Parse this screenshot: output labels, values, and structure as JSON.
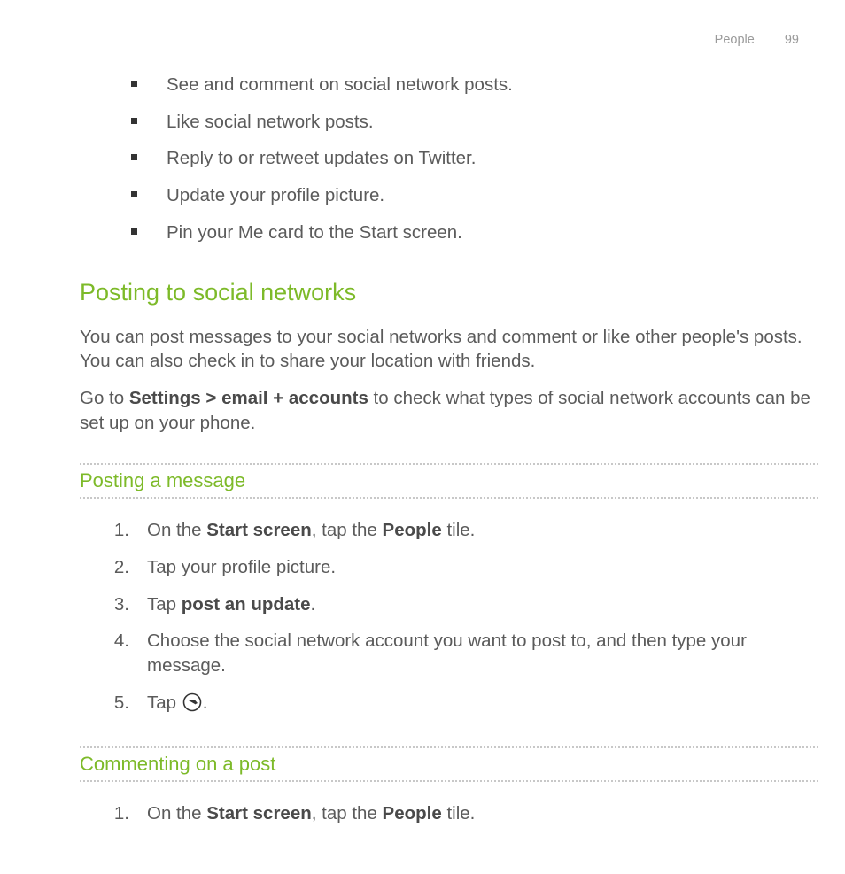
{
  "header": {
    "section": "People",
    "page_number": "99"
  },
  "bullets": [
    "See and comment on social network posts.",
    "Like social network posts.",
    "Reply to or retweet updates on Twitter.",
    "Update your profile picture.",
    "Pin your Me card to the Start screen."
  ],
  "section_title": "Posting to social networks",
  "para1": "You can post messages to your social networks and comment or like other people's posts. You can also check in to share your location with friends.",
  "para2_pre": "Go to ",
  "para2_bold": "Settings > email + accounts",
  "para2_post": " to check what types of social network accounts can be set up on your phone.",
  "sub1": "Posting a message",
  "steps1": {
    "s1_pre": "On the ",
    "s1_b1": "Start screen",
    "s1_mid": ", tap the ",
    "s1_b2": "People",
    "s1_post": " tile.",
    "s2": "Tap your profile picture.",
    "s3_pre": "Tap ",
    "s3_b": "post an update",
    "s3_post": ".",
    "s4": "Choose the social network account you want to post to, and then type your message.",
    "s5_pre": "Tap ",
    "s5_post": "."
  },
  "sub2": "Commenting on a post",
  "steps2": {
    "s1_pre": "On the ",
    "s1_b1": "Start screen",
    "s1_mid": ", tap the ",
    "s1_b2": "People",
    "s1_post": " tile."
  }
}
